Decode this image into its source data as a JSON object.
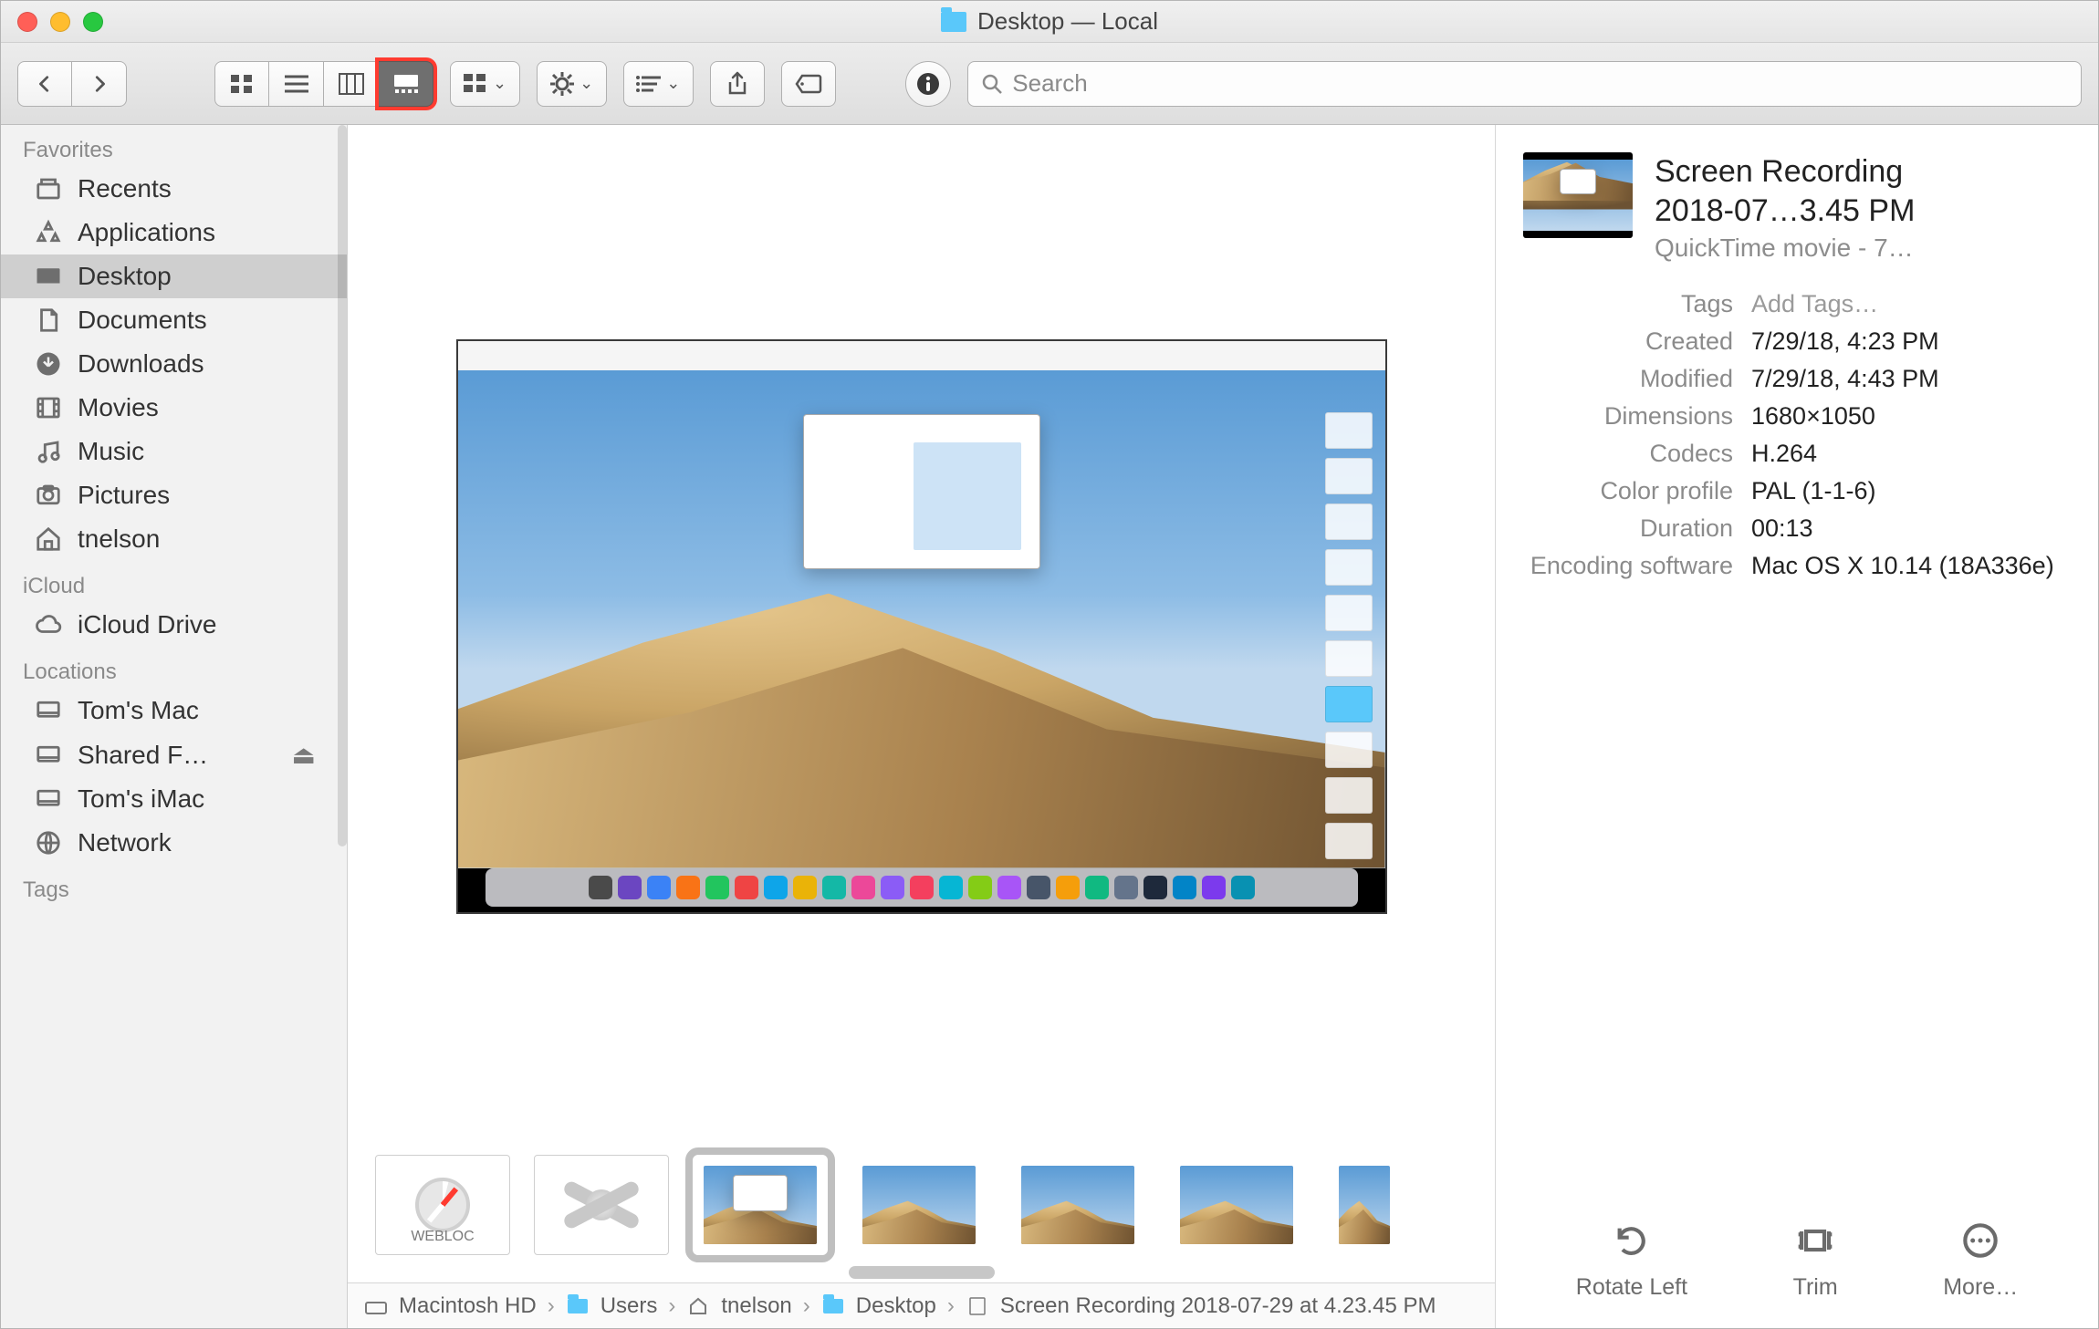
{
  "window": {
    "title": "Desktop — Local"
  },
  "toolbar": {
    "search_placeholder": "Search"
  },
  "sidebar": {
    "sections": {
      "favorites": "Favorites",
      "icloud": "iCloud",
      "locations": "Locations",
      "tags": "Tags"
    },
    "favorites": [
      {
        "label": "Recents"
      },
      {
        "label": "Applications"
      },
      {
        "label": "Desktop"
      },
      {
        "label": "Documents"
      },
      {
        "label": "Downloads"
      },
      {
        "label": "Movies"
      },
      {
        "label": "Music"
      },
      {
        "label": "Pictures"
      },
      {
        "label": "tnelson"
      }
    ],
    "icloud": [
      {
        "label": "iCloud Drive"
      }
    ],
    "locations": [
      {
        "label": "Tom's Mac"
      },
      {
        "label": "Shared F…",
        "eject": true
      },
      {
        "label": "Tom's iMac"
      },
      {
        "label": "Network"
      }
    ]
  },
  "filmstrip": {
    "items": [
      {
        "kind": "webloc",
        "label": "WEBLOC"
      },
      {
        "kind": "xapp"
      },
      {
        "kind": "movie",
        "selected": true
      },
      {
        "kind": "image"
      },
      {
        "kind": "image"
      },
      {
        "kind": "image"
      },
      {
        "kind": "image"
      }
    ]
  },
  "pathbar": [
    "Macintosh HD",
    "Users",
    "tnelson",
    "Desktop",
    "Screen Recording 2018-07-29 at 4.23.45 PM"
  ],
  "inspector": {
    "title_line1": "Screen Recording",
    "title_line2": "2018-07…3.45 PM",
    "subtitle": "QuickTime movie - 7…",
    "tags_label": "Tags",
    "tags_placeholder": "Add Tags…",
    "fields": [
      {
        "k": "Created",
        "v": "7/29/18, 4:23 PM"
      },
      {
        "k": "Modified",
        "v": "7/29/18, 4:43 PM"
      },
      {
        "k": "Dimensions",
        "v": "1680×1050"
      },
      {
        "k": "Codecs",
        "v": "H.264"
      },
      {
        "k": "Color profile",
        "v": "PAL (1-1-6)"
      },
      {
        "k": "Duration",
        "v": "00:13"
      },
      {
        "k": "Encoding software",
        "v": "Mac OS X 10.14 (18A336e)"
      }
    ],
    "actions": {
      "rotate": "Rotate Left",
      "trim": "Trim",
      "more": "More…"
    }
  }
}
